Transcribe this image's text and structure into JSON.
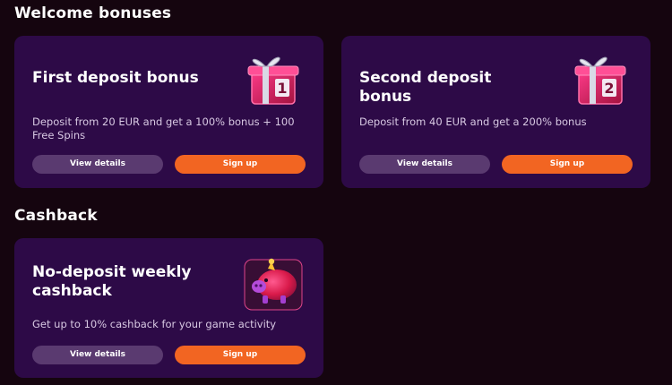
{
  "sections": {
    "welcome_title": "Welcome bonuses",
    "cashback_title": "Cashback"
  },
  "cards": [
    {
      "title": "First deposit bonus",
      "description": "Deposit from 20 EUR and get a 100% bonus + 100 Free Spins",
      "details_label": "View details",
      "signup_label": "Sign up",
      "icon": "gift-box-1-icon",
      "badge": "1"
    },
    {
      "title": "Second deposit bonus",
      "description": "Deposit from 40 EUR and get a 200% bonus",
      "details_label": "View details",
      "signup_label": "Sign up",
      "icon": "gift-box-2-icon",
      "badge": "2"
    },
    {
      "title": "No-deposit weekly cashback",
      "description": "Get up to 10% cashback for your game activity",
      "details_label": "View details",
      "signup_label": "Sign up",
      "icon": "piggy-bank-icon"
    }
  ],
  "colors": {
    "background": "#15050f",
    "card": "#2d0a47",
    "primary_button": "#f26522",
    "secondary_button": "#5a3a70"
  }
}
